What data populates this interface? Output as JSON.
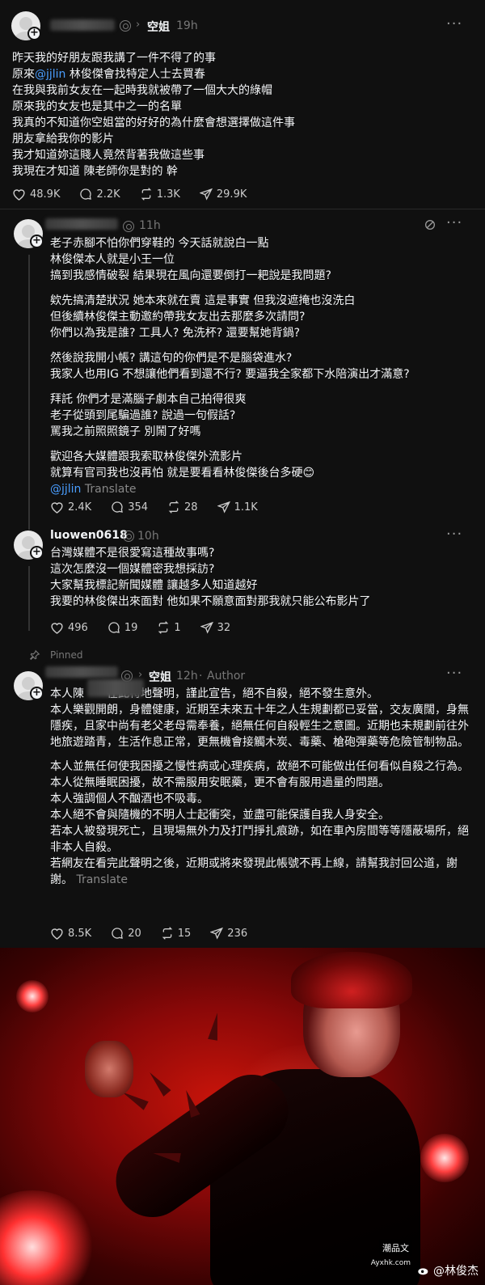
{
  "post1": {
    "username": "空姐",
    "time": "19h",
    "lines": [
      "昨天我的好朋友跟我講了一件不得了的事",
      "原來",
      "在我與我前女友在一起時我就被帶了一個大大的綠帽",
      "原來我的女友也是其中之一的名單",
      "我真的不知道你空姐當的好好的為什麼會想選擇做這件事",
      "朋友拿給我你的影片",
      "我才知道妳這賤人竟然背著我做這些事",
      "我現在才知道 陳老師你是對的 幹"
    ],
    "mention": "@jjlin",
    "line2_rest": " 林俊傑會找特定人士去買春",
    "likes": "48.9K",
    "comments": "2.2K",
    "reposts": "1.3K",
    "shares": "29.9K"
  },
  "reply1": {
    "time": "11h",
    "block1": [
      "老子赤腳不怕你們穿鞋的 今天話就說白一點",
      "林俊傑本人就是小王一位",
      "搞到我感情破裂 結果現在風向還要倒打一耙說是我問題?"
    ],
    "block2": [
      "欸先搞清楚狀況 她本來就在賣 這是事實 但我沒遮掩也沒洗白",
      "但後續林俊傑主動邀約帶我女友出去那麼多次請問?",
      "你們以為我是誰? 工具人? 免洗杯? 還要幫她背鍋?"
    ],
    "block3": [
      "然後說我開小帳? 講這句的你們是不是腦袋進水?",
      "我家人也用IG 不想讓他們看到還不行? 要逼我全家都下水陪演出才滿意?"
    ],
    "block4": [
      "拜託 你們才是滿腦子劇本自己拍得很爽",
      "老子從頭到尾騙過誰? 說過一句假話?",
      "罵我之前照照鏡子 別鬧了好嗎"
    ],
    "block5": [
      "歡迎各大媒體跟我索取林俊傑外流影片",
      "就算有官司我也沒再怕 就是要看看林俊傑後台多硬😊"
    ],
    "mention": "@jjlin",
    "translate": "Translate",
    "likes": "2.4K",
    "comments": "354",
    "reposts": "28",
    "shares": "1.1K"
  },
  "reply2": {
    "username": "luowen0618",
    "time": "10h",
    "lines": [
      "台灣媒體不是很愛寫這種故事嗎?",
      "這次怎麼沒一個媒體密我想採訪?",
      "大家幫我標記新聞媒體 讓越多人知道越好",
      "我要的林俊傑出來面對 他如果不願意面對那我就只能公布影片了"
    ],
    "likes": "496",
    "comments": "19",
    "reposts": "1",
    "shares": "32"
  },
  "pinned": {
    "label": "Pinned",
    "username": "空姐",
    "time": "12h",
    "author": "Author",
    "line1_a": "本人陳",
    "line1_b": "在此特地聲明，謹此宣告，絕不自殺，絕不發生意外。",
    "para1": "本人樂觀開朗，身體健康，近期至未來五十年之人生規劃都已妥當，交友廣闊，身無隱疾，且家中尚有老父老母需奉養，絕無任何自殺輕生之意圖。近期也未規劃前往外地旅遊踏青，生活作息正常，更無機會接觸木炭、毒藥、槍砲彈藥等危險管制物品。",
    "para2": "本人並無任何使我困擾之慢性病或心理疾病，故絕不可能做出任何看似自殺之行為。",
    "para3": "本人從無睡眠困擾，故不需服用安眠藥，更不會有服用過量的問題。",
    "para4": "本人強調個人不酗酒也不吸毒。",
    "para5": "本人絕不會與隨機的不明人士起衝突，並盡可能保護自我人身安全。",
    "para6": "若本人被發現死亡，且現場無外力及打鬥掙扎痕跡，如在車內房間等等隱蔽場所，絕非本人自殺。",
    "para7": "若網友在看完此聲明之後，近期或將來發現此帳號不再上線，請幫我討回公道，謝謝。",
    "translate": "Translate",
    "likes": "8.5K",
    "comments": "20",
    "reposts": "15",
    "shares": "236"
  },
  "watermark": {
    "site": "潮品文",
    "url": "Ayxhk.com",
    "handle": "@林俊杰"
  },
  "icons": [
    "plus-icon",
    "swirl-icon",
    "chevron-right-icon",
    "more-icon",
    "heart-icon",
    "comment-icon",
    "repost-icon",
    "share-icon",
    "pin-icon",
    "weibo-icon"
  ]
}
